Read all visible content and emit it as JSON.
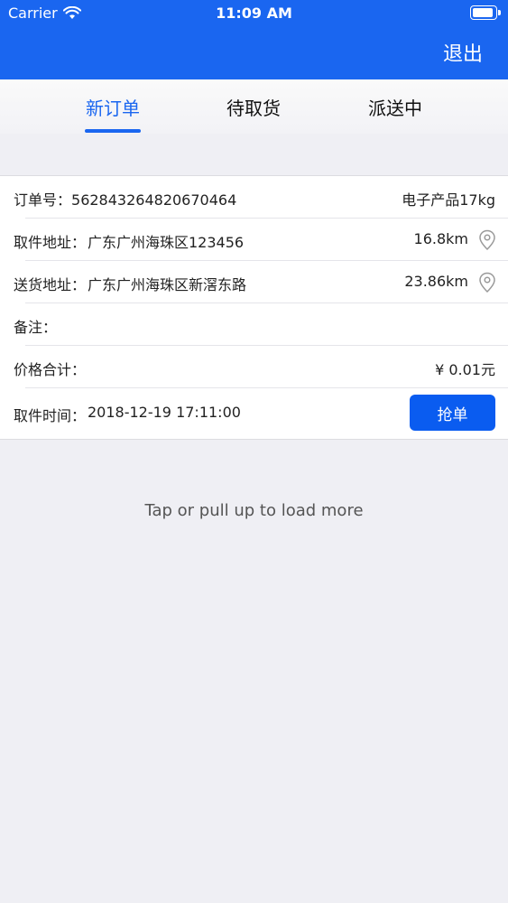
{
  "status_bar": {
    "carrier": "Carrier",
    "time": "11:09 AM",
    "wifi_icon": "wifi-icon",
    "battery_icon": "battery-icon",
    "battery_level": 0.9
  },
  "nav": {
    "exit_label": "退出"
  },
  "tabs": [
    {
      "label": "新订单",
      "active": true
    },
    {
      "label": "待取货",
      "active": false
    },
    {
      "label": "派送中",
      "active": false
    }
  ],
  "order": {
    "order_no_label": "订单号：",
    "order_no": "562843264820670464",
    "goods": "电子产品17kg",
    "pickup_label": "取件地址：",
    "pickup_address": "广东广州海珠区123456",
    "pickup_distance": "16.8km",
    "delivery_label": "送货地址：",
    "delivery_address": "广东广州海珠区新滘东路",
    "delivery_distance": "23.86km",
    "remark_label": "备注：",
    "remark": "",
    "price_label": "价格合计：",
    "price": "¥ 0.01元",
    "pickup_time_label": "取件时间：",
    "pickup_time": "2018-12-19 17:11:00",
    "grab_label": "抢单",
    "location_icon": "location-pin-icon"
  },
  "footer": {
    "load_more": "Tap or pull up to load more"
  },
  "colors": {
    "primary": "#1a66f0",
    "button": "#0a5cf0",
    "background": "#efeff4"
  }
}
